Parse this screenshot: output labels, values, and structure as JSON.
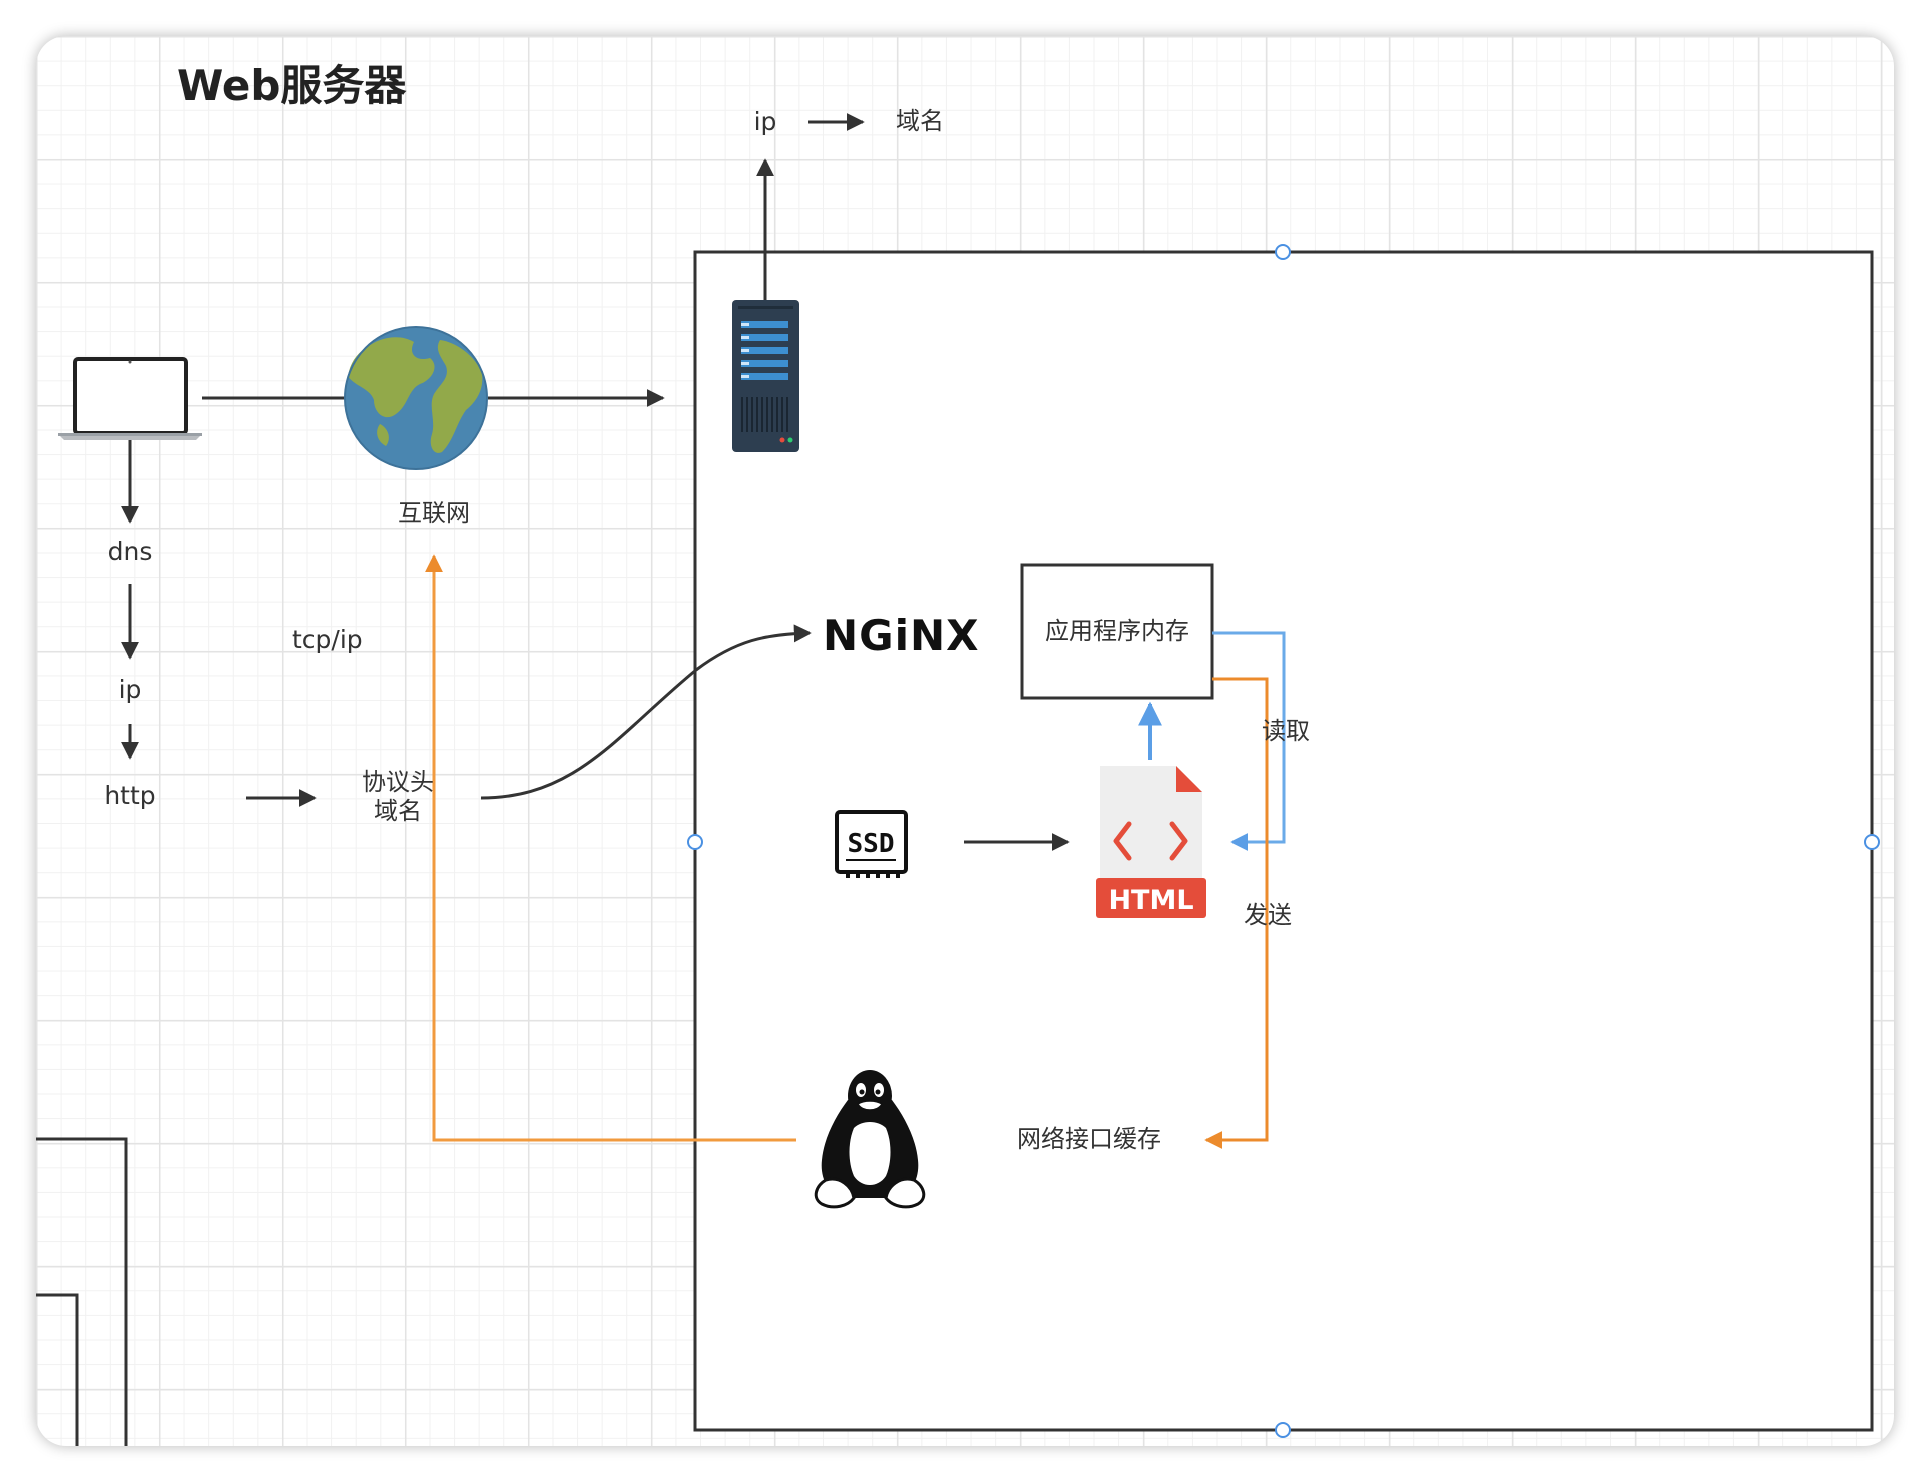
{
  "title": "Web服务器",
  "labels": {
    "dns": "dns",
    "ip_left": "ip",
    "http": "http",
    "internet": "互联网",
    "tcpip": "tcp/ip",
    "protocol_header_line1": "协议头",
    "protocol_header_line2": "域名",
    "ip_top": "ip",
    "domain_top": "域名",
    "app_memory": "应用程序内存",
    "read": "读取",
    "send": "发送",
    "network_cache": "网络接口缓存",
    "nginx_logo_text": "NGiNX",
    "ssd_logo_text": "SSD",
    "html_badge_text": "HTML"
  },
  "colors": {
    "line": "#333333",
    "blue_arrow": "#6aaae8",
    "orange_arrow": "#f19a3e",
    "html_red": "#e44d3a",
    "globe_ocean": "#4a86b0",
    "globe_land": "#92a94a",
    "server_body": "#2d3e50",
    "server_stripe": "#3d8fd0"
  },
  "icons": [
    "laptop-icon",
    "globe-icon",
    "server-icon",
    "nginx-logo",
    "ssd-icon",
    "html-file-icon",
    "linux-penguin-icon"
  ]
}
